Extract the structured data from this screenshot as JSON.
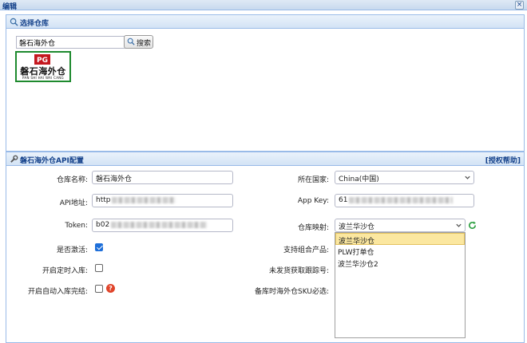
{
  "window": {
    "title": "编辑",
    "close_label": "×"
  },
  "warehouse_select": {
    "header": "选择仓库",
    "search_value": "磐石海外仓",
    "search_button": "搜索",
    "card": {
      "mark": "PG",
      "name_cn": "磐石海外仓",
      "name_en": "PAN SHI HAI WAI CANG"
    }
  },
  "api_config": {
    "header": "磐石海外仓API配置",
    "help_link": "[授权帮助]",
    "fields": {
      "warehouse_name": {
        "label": "仓库名称:",
        "value": "磐石海外仓"
      },
      "country": {
        "label": "所在国家:",
        "value": "China(中国)"
      },
      "api_url": {
        "label": "API地址:",
        "value": "http"
      },
      "app_key": {
        "label": "App Key:",
        "value": "61"
      },
      "token": {
        "label": "Token:",
        "value": "b02"
      },
      "warehouse_mapping": {
        "label": "仓库映射:",
        "value": "波兰华沙仓"
      },
      "activate": {
        "label": "是否激活:",
        "checked": true
      },
      "support_combo": {
        "label": "支持组合产品:"
      },
      "timed_inbound": {
        "label": "开启定时入库:",
        "checked": false
      },
      "unshipped_tracking": {
        "label": "未发货获取跟踪号:"
      },
      "auto_inbound_complete": {
        "label": "开启自动入库完结:",
        "checked": false,
        "help_icon": "?"
      },
      "sku_required": {
        "label": "备库时海外仓SKU必选:"
      }
    },
    "mapping_options": [
      "波兰华沙仓",
      "PLW打单仓",
      "波兰华沙仓2"
    ]
  }
}
